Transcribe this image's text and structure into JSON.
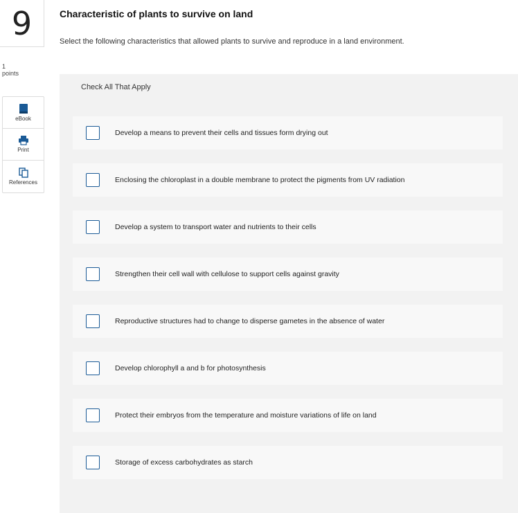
{
  "question": {
    "number": "9",
    "points_value": "1",
    "points_label": "points",
    "title": "Characteristic of plants to survive on land",
    "prompt": "Select the following characteristics that allowed plants to survive and reproduce in a land environment.",
    "instruction": "Check All That Apply"
  },
  "tools": [
    {
      "label": "eBook",
      "icon": "book-icon"
    },
    {
      "label": "Print",
      "icon": "printer-icon"
    },
    {
      "label": "References",
      "icon": "copy-icon"
    }
  ],
  "options": [
    {
      "label": "Develop a means to prevent their cells and tissues form drying out",
      "checked": false
    },
    {
      "label": "Enclosing the chloroplast in a double membrane to protect the pigments from UV radiation",
      "checked": false
    },
    {
      "label": "Develop a system to transport water and nutrients to their cells",
      "checked": false
    },
    {
      "label": "Strengthen their cell wall with cellulose to support cells against gravity",
      "checked": false
    },
    {
      "label": "Reproductive structures had to change to disperse gametes in the absence of water",
      "checked": false
    },
    {
      "label": "Develop chlorophyll a and b for photosynthesis",
      "checked": false
    },
    {
      "label": "Protect their embryos from the temperature and moisture variations of life on land",
      "checked": false
    },
    {
      "label": "Storage of excess carbohydrates as starch",
      "checked": false
    }
  ],
  "colors": {
    "accent": "#1a5a96",
    "panel_bg": "#f2f2f2",
    "option_bg": "#f8f8f8"
  }
}
